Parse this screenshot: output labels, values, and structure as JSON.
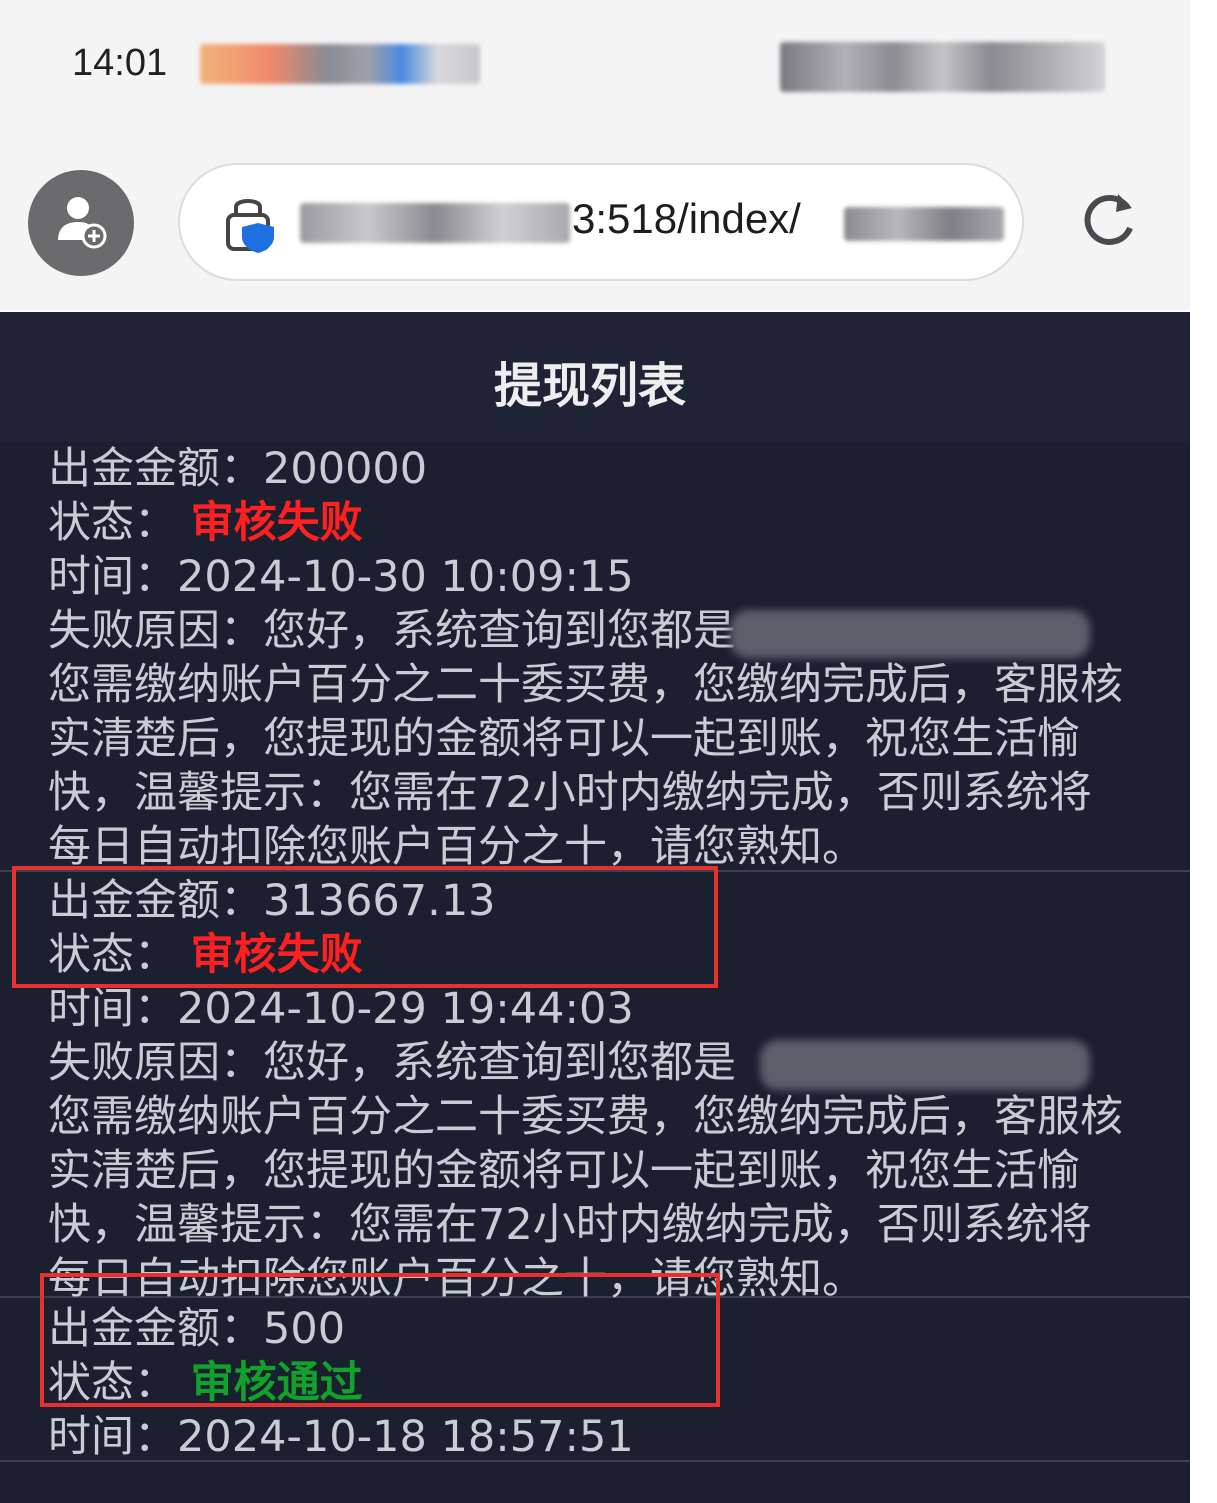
{
  "status_bar": {
    "time": "14:01"
  },
  "browser": {
    "url_visible_fragment": "3:518/index/"
  },
  "page": {
    "title": "提现列表"
  },
  "labels": {
    "amount": "出金金额：",
    "status": "状态：",
    "time": "时间：",
    "reason": "失败原因："
  },
  "records": [
    {
      "amount": "200000",
      "status": "审核失败",
      "status_type": "failed",
      "time": "2024-10-30 10:09:15",
      "reason_line1": "您好，系统查询到您都是",
      "reason_rest": "您需缴纳账户百分之二十委买费，您缴纳完成后，客服核实清楚后，您提现的金额将可以一起到账，祝您生活愉快，温馨提示：您需在72小时内缴纳完成，否则系统将每日自动扣除您账户百分之十，请您熟知。"
    },
    {
      "amount": "313667.13",
      "status": "审核失败",
      "status_type": "failed",
      "time": "2024-10-29 19:44:03",
      "reason_line1": "您好，系统查询到您都是",
      "reason_rest": "您需缴纳账户百分之二十委买费，您缴纳完成后，客服核实清楚后，您提现的金额将可以一起到账，祝您生活愉快，温馨提示：您需在72小时内缴纳完成，否则系统将每日自动扣除您账户百分之十，请您熟知。"
    },
    {
      "amount": "500",
      "status": "审核通过",
      "status_type": "approved",
      "time": "2024-10-18 18:57:51"
    }
  ],
  "colors": {
    "page_bg": "#1b2030",
    "text": "#c9ccd2",
    "status_failed": "#ff2020",
    "status_approved": "#12a12a",
    "highlight_box": "#e8312f"
  }
}
